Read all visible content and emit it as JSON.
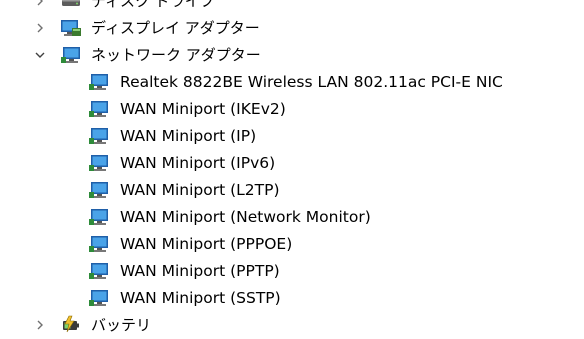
{
  "tree": {
    "categories": [
      {
        "label": "ディスク ドライブ",
        "expanded": false,
        "icon": "disk-drive-icon",
        "children": []
      },
      {
        "label": "ディスプレイ アダプター",
        "expanded": false,
        "icon": "display-adapter-icon",
        "children": []
      },
      {
        "label": "ネットワーク アダプター",
        "expanded": true,
        "icon": "network-adapter-icon",
        "children": [
          {
            "label": "Realtek 8822BE Wireless LAN 802.11ac PCI-E NIC"
          },
          {
            "label": "WAN Miniport (IKEv2)"
          },
          {
            "label": "WAN Miniport (IP)"
          },
          {
            "label": "WAN Miniport (IPv6)"
          },
          {
            "label": "WAN Miniport (L2TP)"
          },
          {
            "label": "WAN Miniport (Network Monitor)"
          },
          {
            "label": "WAN Miniport (PPPOE)"
          },
          {
            "label": "WAN Miniport (PPTP)"
          },
          {
            "label": "WAN Miniport (SSTP)"
          }
        ]
      },
      {
        "label": "バッテリ",
        "expanded": false,
        "icon": "battery-icon",
        "children": []
      }
    ],
    "child_icon": "network-adapter-icon"
  },
  "colors": {
    "text": "#000000",
    "expander": "#707070",
    "monitor_frame": "#1f5fa8",
    "monitor_screen": "#4aa3e8"
  }
}
